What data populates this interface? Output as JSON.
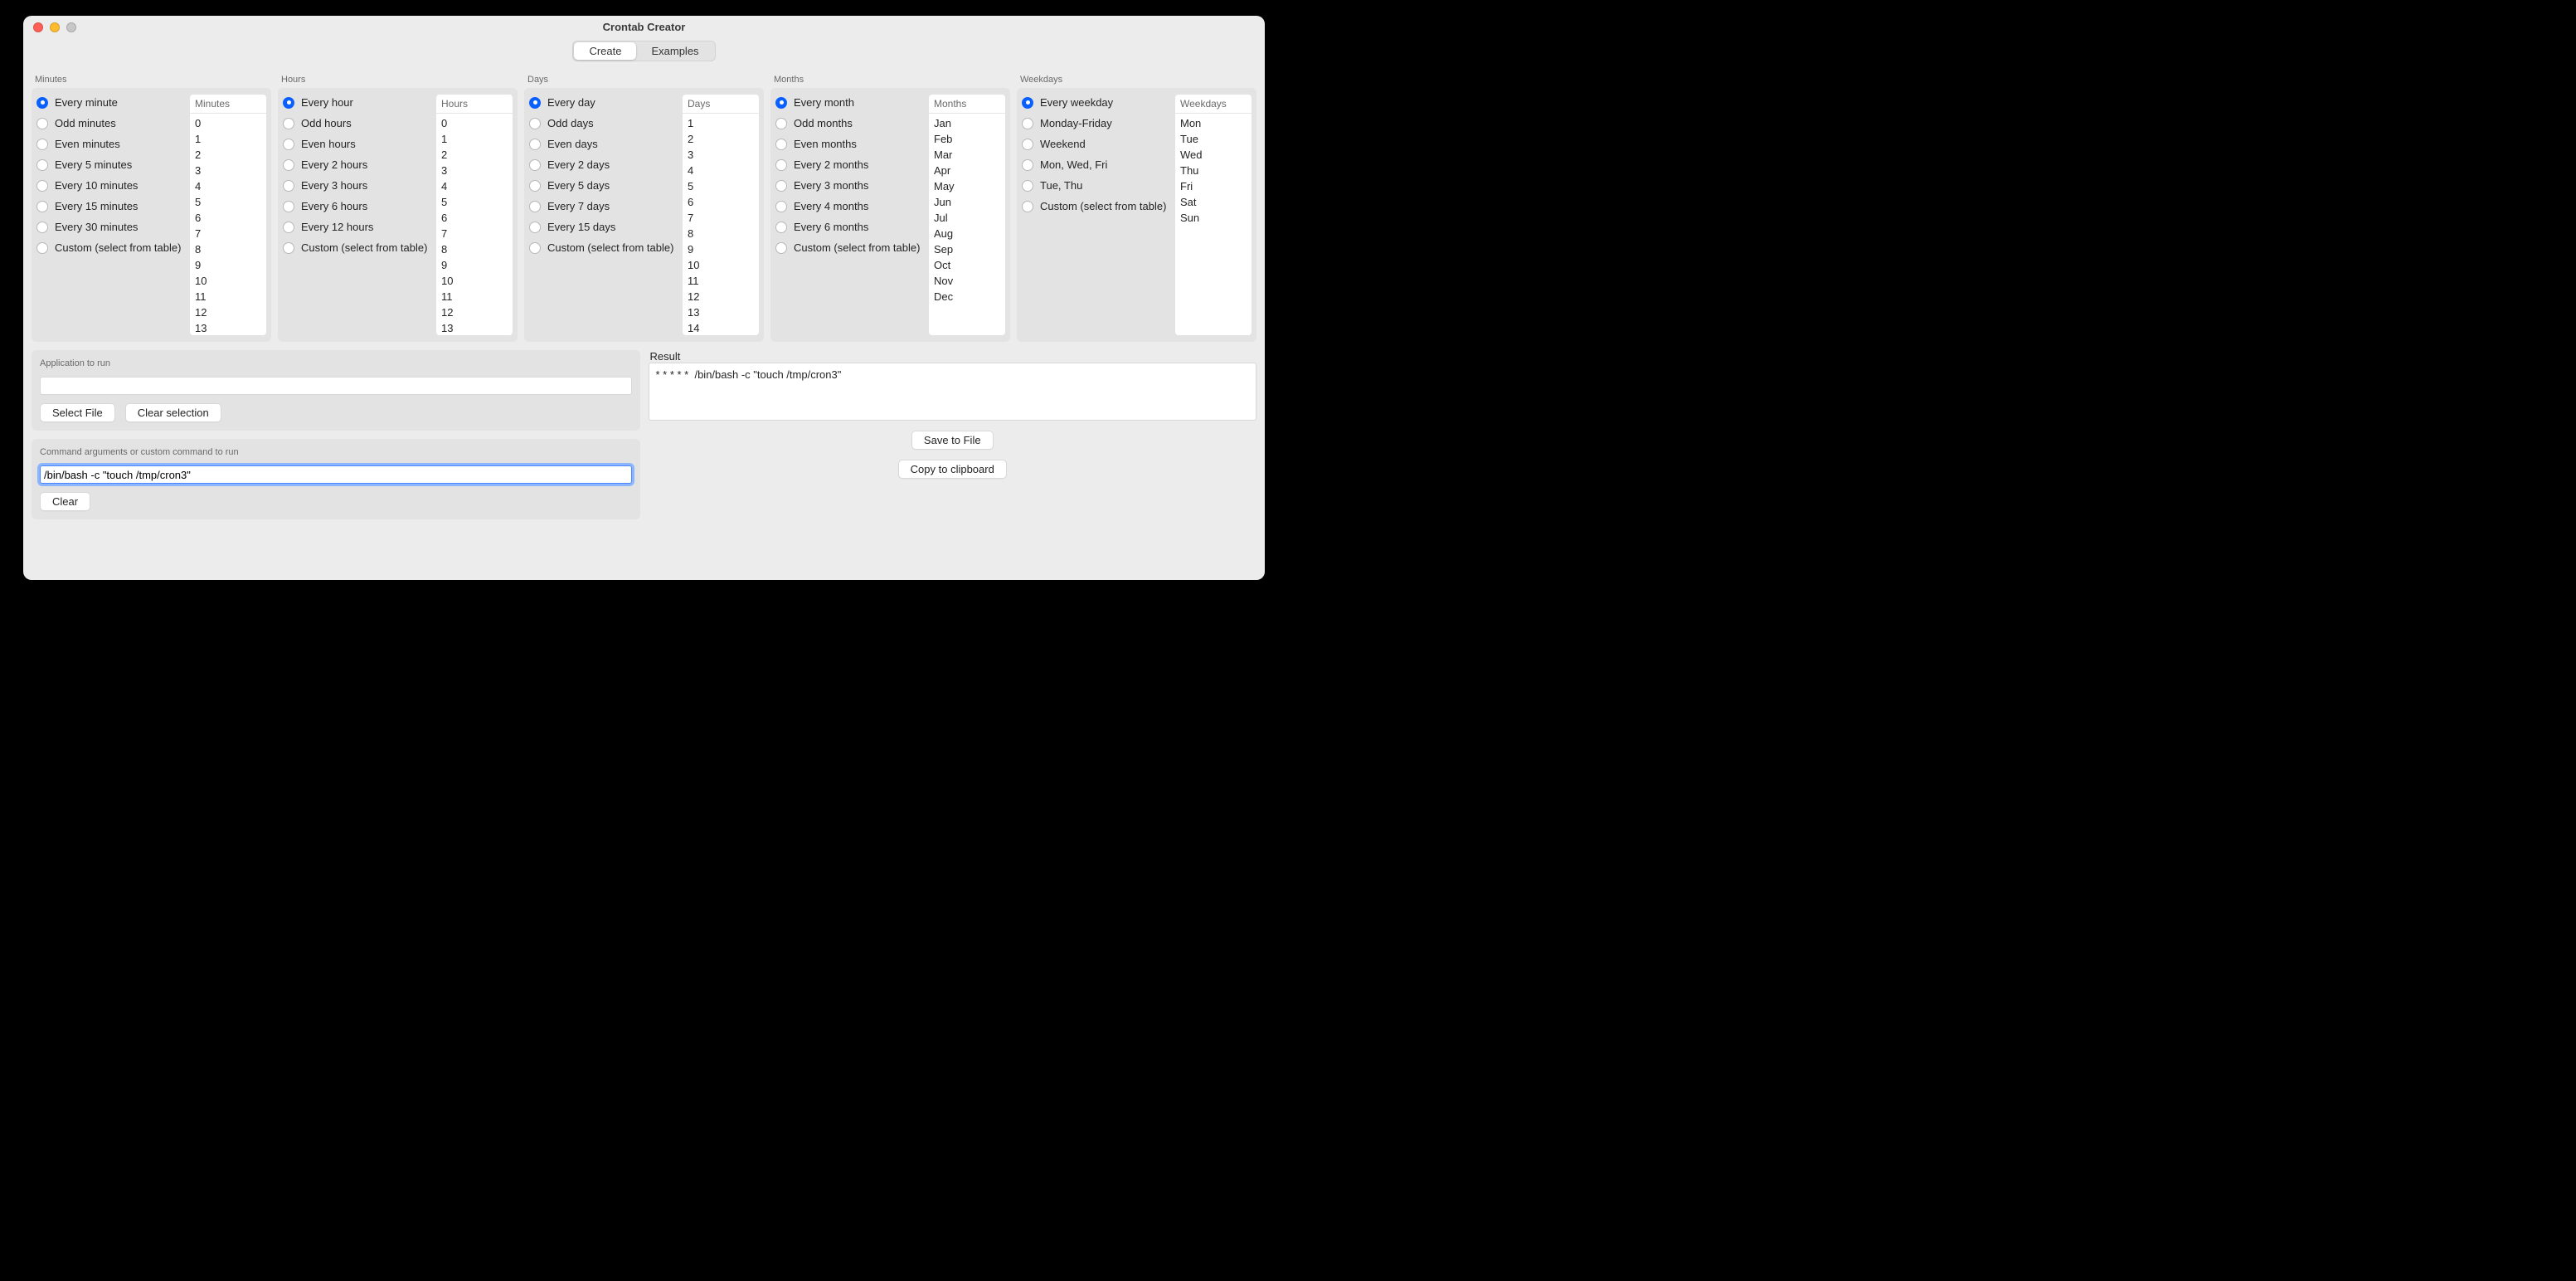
{
  "window": {
    "title": "Crontab Creator"
  },
  "tabs": {
    "create": "Create",
    "examples": "Examples",
    "active": "create"
  },
  "columns": {
    "minutes": {
      "header": "Minutes",
      "options": [
        "Every minute",
        "Odd minutes",
        "Even minutes",
        "Every 5 minutes",
        "Every 10 minutes",
        "Every 15 minutes",
        "Every 30 minutes",
        "Custom (select from table)"
      ],
      "selected": 0,
      "list_header": "Minutes",
      "list_items": [
        "0",
        "1",
        "2",
        "3",
        "4",
        "5",
        "6",
        "7",
        "8",
        "9",
        "10",
        "11",
        "12",
        "13"
      ]
    },
    "hours": {
      "header": "Hours",
      "options": [
        "Every hour",
        "Odd hours",
        "Even hours",
        "Every 2 hours",
        "Every 3 hours",
        "Every 6 hours",
        "Every 12 hours",
        "Custom (select from table)"
      ],
      "selected": 0,
      "list_header": "Hours",
      "list_items": [
        "0",
        "1",
        "2",
        "3",
        "4",
        "5",
        "6",
        "7",
        "8",
        "9",
        "10",
        "11",
        "12",
        "13"
      ]
    },
    "days": {
      "header": "Days",
      "options": [
        "Every day",
        "Odd days",
        "Even days",
        "Every 2 days",
        "Every 5 days",
        "Every 7 days",
        "Every 15 days",
        "Custom (select from table)"
      ],
      "selected": 0,
      "list_header": "Days",
      "list_items": [
        "1",
        "2",
        "3",
        "4",
        "5",
        "6",
        "7",
        "8",
        "9",
        "10",
        "11",
        "12",
        "13",
        "14"
      ]
    },
    "months": {
      "header": "Months",
      "options": [
        "Every month",
        "Odd months",
        "Even months",
        "Every 2 months",
        "Every 3 months",
        "Every 4 months",
        "Every 6 months",
        "Custom (select from table)"
      ],
      "selected": 0,
      "list_header": "Months",
      "list_items": [
        "Jan",
        "Feb",
        "Mar",
        "Apr",
        "May",
        "Jun",
        "Jul",
        "Aug",
        "Sep",
        "Oct",
        "Nov",
        "Dec"
      ]
    },
    "weekdays": {
      "header": "Weekdays",
      "options": [
        "Every weekday",
        "Monday-Friday",
        "Weekend",
        "Mon, Wed, Fri",
        "Tue, Thu",
        "Custom (select from table)"
      ],
      "selected": 0,
      "list_header": "Weekdays",
      "list_items": [
        "Mon",
        "Tue",
        "Wed",
        "Thu",
        "Fri",
        "Sat",
        "Sun"
      ]
    }
  },
  "app_panel": {
    "title": "Application to run",
    "value": "",
    "select_file": "Select File",
    "clear_selection": "Clear selection"
  },
  "cmd_panel": {
    "title": "Command arguments or custom command to run",
    "value": "/bin/bash -c \"touch /tmp/cron3\"",
    "clear": "Clear"
  },
  "result_panel": {
    "title": "Result",
    "value": "* * * * *  /bin/bash -c \"touch /tmp/cron3\"",
    "save": "Save to File",
    "copy": "Copy to clipboard"
  }
}
